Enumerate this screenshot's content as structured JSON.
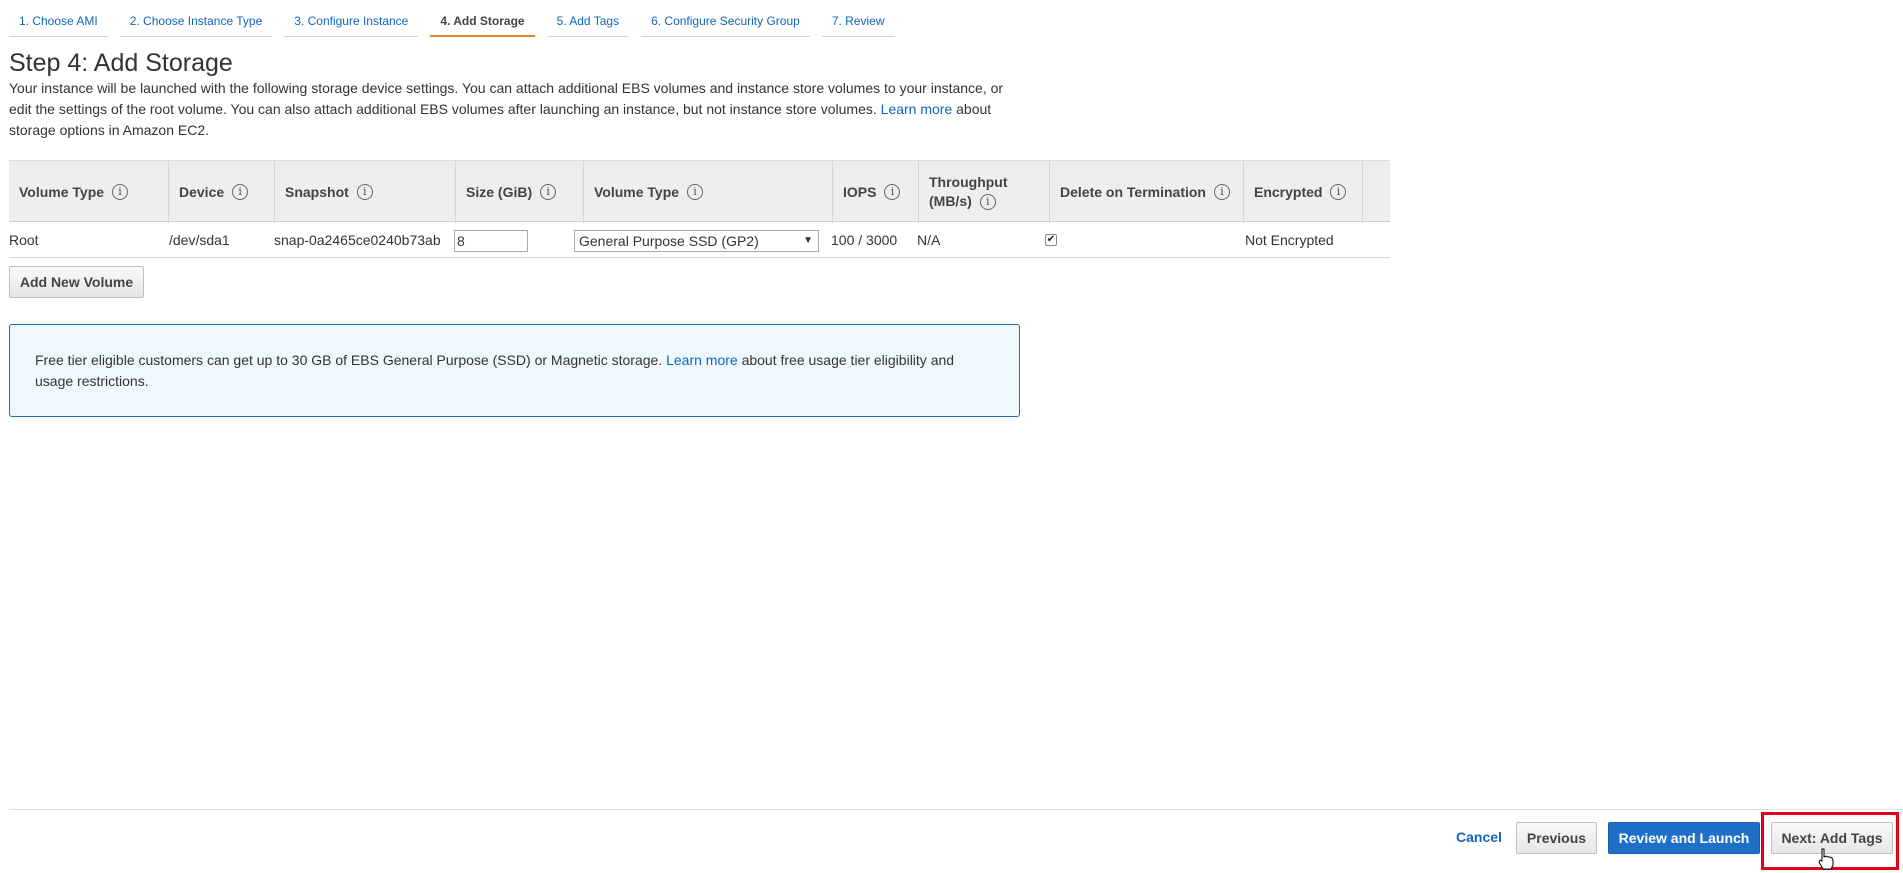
{
  "tabs": [
    {
      "label": "1. Choose AMI"
    },
    {
      "label": "2. Choose Instance Type"
    },
    {
      "label": "3. Configure Instance"
    },
    {
      "label": "4. Add Storage",
      "active": true
    },
    {
      "label": "5. Add Tags"
    },
    {
      "label": "6. Configure Security Group"
    },
    {
      "label": "7. Review"
    }
  ],
  "page": {
    "title": "Step 4: Add Storage",
    "desc_before": "Your instance will be launched with the following storage device settings. You can attach additional EBS volumes and instance store volumes to your instance, or edit the settings of the root volume. You can also attach additional EBS volumes after launching an instance, but not instance store volumes.",
    "desc_link": "Learn more",
    "desc_after": "about storage options in Amazon EC2."
  },
  "table": {
    "headers": {
      "volume_type": "Volume Type",
      "device": "Device",
      "snapshot": "Snapshot",
      "size": "Size (GiB)",
      "volume_type2": "Volume Type",
      "iops": "IOPS",
      "throughput_1": "Throughput",
      "throughput_2": "(MB/s)",
      "delete": "Delete on Termination",
      "encrypted": "Encrypted"
    },
    "row": {
      "volume_type": "Root",
      "device": "/dev/sda1",
      "snapshot": "snap-0a2465ce0240b73ab",
      "size": "8",
      "volume_type_selected": "General Purpose SSD (GP2)",
      "iops": "100 / 3000",
      "throughput": "N/A",
      "delete_on_termination": true,
      "encrypted": "Not Encrypted"
    },
    "info_glyph": "i"
  },
  "add_volume_label": "Add New Volume",
  "notice": {
    "before": "Free tier eligible customers can get up to 30 GB of EBS General Purpose (SSD) or Magnetic storage.",
    "link": "Learn more",
    "after": "about free usage tier eligibility and usage restrictions."
  },
  "footer": {
    "cancel": "Cancel",
    "previous": "Previous",
    "review_launch": "Review and Launch",
    "next": "Next: Add Tags"
  },
  "colors": {
    "accent": "#e8862e",
    "link": "#1166bb",
    "primary_button": "#1e6fc7",
    "highlight": "#e2001a",
    "notice_bg": "#eff8fd"
  }
}
